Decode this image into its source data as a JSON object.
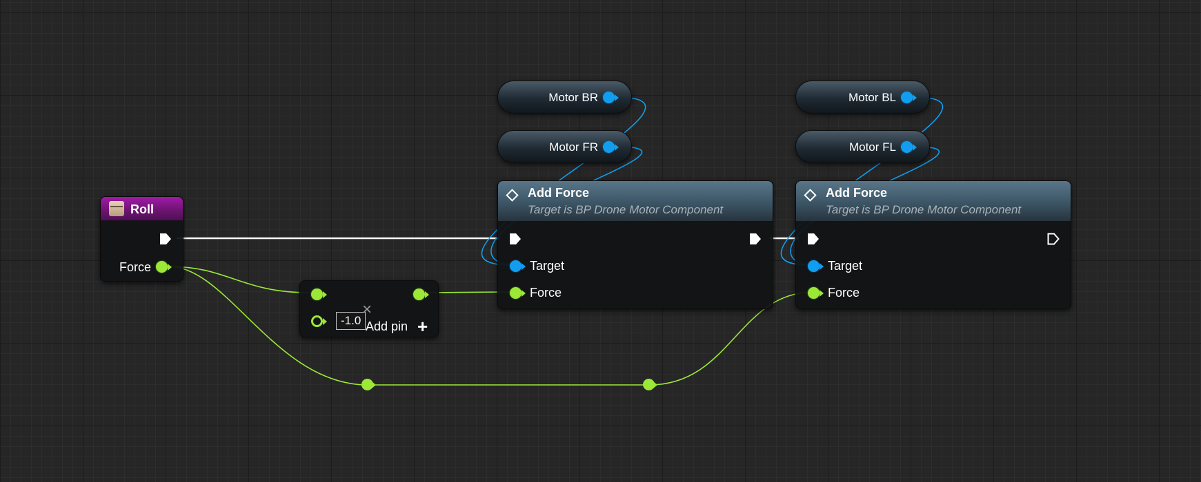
{
  "graph": {
    "colors": {
      "exec": "#ffffff",
      "object_pin": "#119ef0",
      "float_pin": "#9be837",
      "event_header": "#8a1a90",
      "function_header": "#4a6678",
      "background": "#262626"
    },
    "event_node": {
      "title": "Roll",
      "icon": "event-icon",
      "outputs": {
        "force_label": "Force"
      }
    },
    "multiply_node": {
      "constant_value": "-1.0",
      "add_pin_label": "Add pin",
      "remove_icon": "×",
      "add_icon": "+"
    },
    "variables": [
      {
        "label": "Motor BR"
      },
      {
        "label": "Motor FR"
      },
      {
        "label": "Motor BL"
      },
      {
        "label": "Motor FL"
      }
    ],
    "add_force_nodes": [
      {
        "title": "Add Force",
        "subtitle": "Target is BP Drone Motor Component",
        "target_label": "Target",
        "force_label": "Force",
        "exec_out_connected": true
      },
      {
        "title": "Add Force",
        "subtitle": "Target is BP Drone Motor Component",
        "target_label": "Target",
        "force_label": "Force",
        "exec_out_connected": false
      }
    ]
  }
}
